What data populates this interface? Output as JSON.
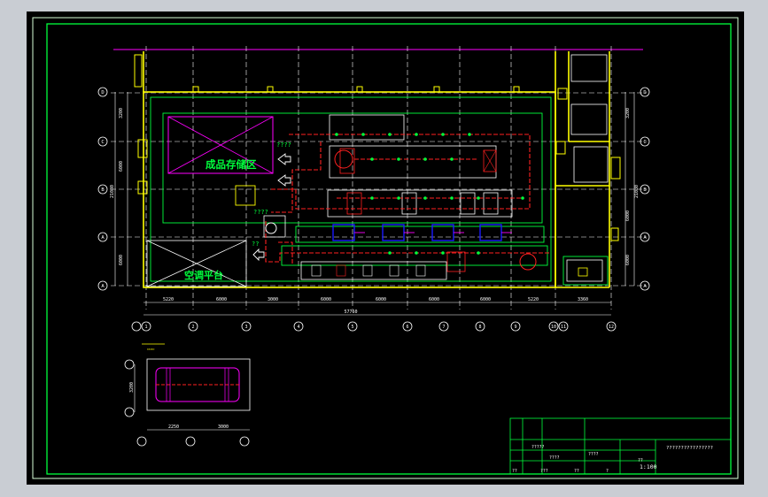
{
  "drawing": {
    "zone_labels": {
      "finished_goods": "成品存储区",
      "ac_platform": "空调平台"
    },
    "question_marks": [
      "????",
      "????",
      "??"
    ],
    "dimensions": {
      "bottom_segments": [
        "5220",
        "6000",
        "3000",
        "6000",
        "6000",
        "6000",
        "6000",
        "6000",
        "5220"
      ],
      "bottom_total": "57760",
      "bottom_right": "3360",
      "left_segments": [
        "3200",
        "6000",
        "6000",
        "6000"
      ],
      "left_total": "21080",
      "right_segments": [
        "3200",
        "6000",
        "6000",
        "6000"
      ],
      "right_total": "21080",
      "inset_left": "3200",
      "inset_bottom": [
        "2250",
        "3000"
      ]
    },
    "axis_letters_left": [
      "D",
      "C",
      "B",
      "A",
      "A"
    ],
    "axis_numbers_bottom": [
      "1",
      "2",
      "3",
      "4",
      "5",
      "6",
      "7",
      "8",
      "9",
      "10",
      "11",
      "12"
    ],
    "scale": "1:100",
    "title_text": "????????????????",
    "title_block_small": [
      "?????",
      "????",
      "????",
      "???",
      "??",
      "??",
      "?",
      "??"
    ]
  },
  "colors": {
    "model_bg": "#000000",
    "frame_green": "#00ff3c",
    "outer_frame": "#ffffff",
    "walls": "#ffff00",
    "duct_red": "#ff2020",
    "zone_magenta": "#ff00ff",
    "equipment_cyan": "#00d0ff",
    "grid_white": "#ffffff",
    "fan_blue": "#1a1aff"
  }
}
